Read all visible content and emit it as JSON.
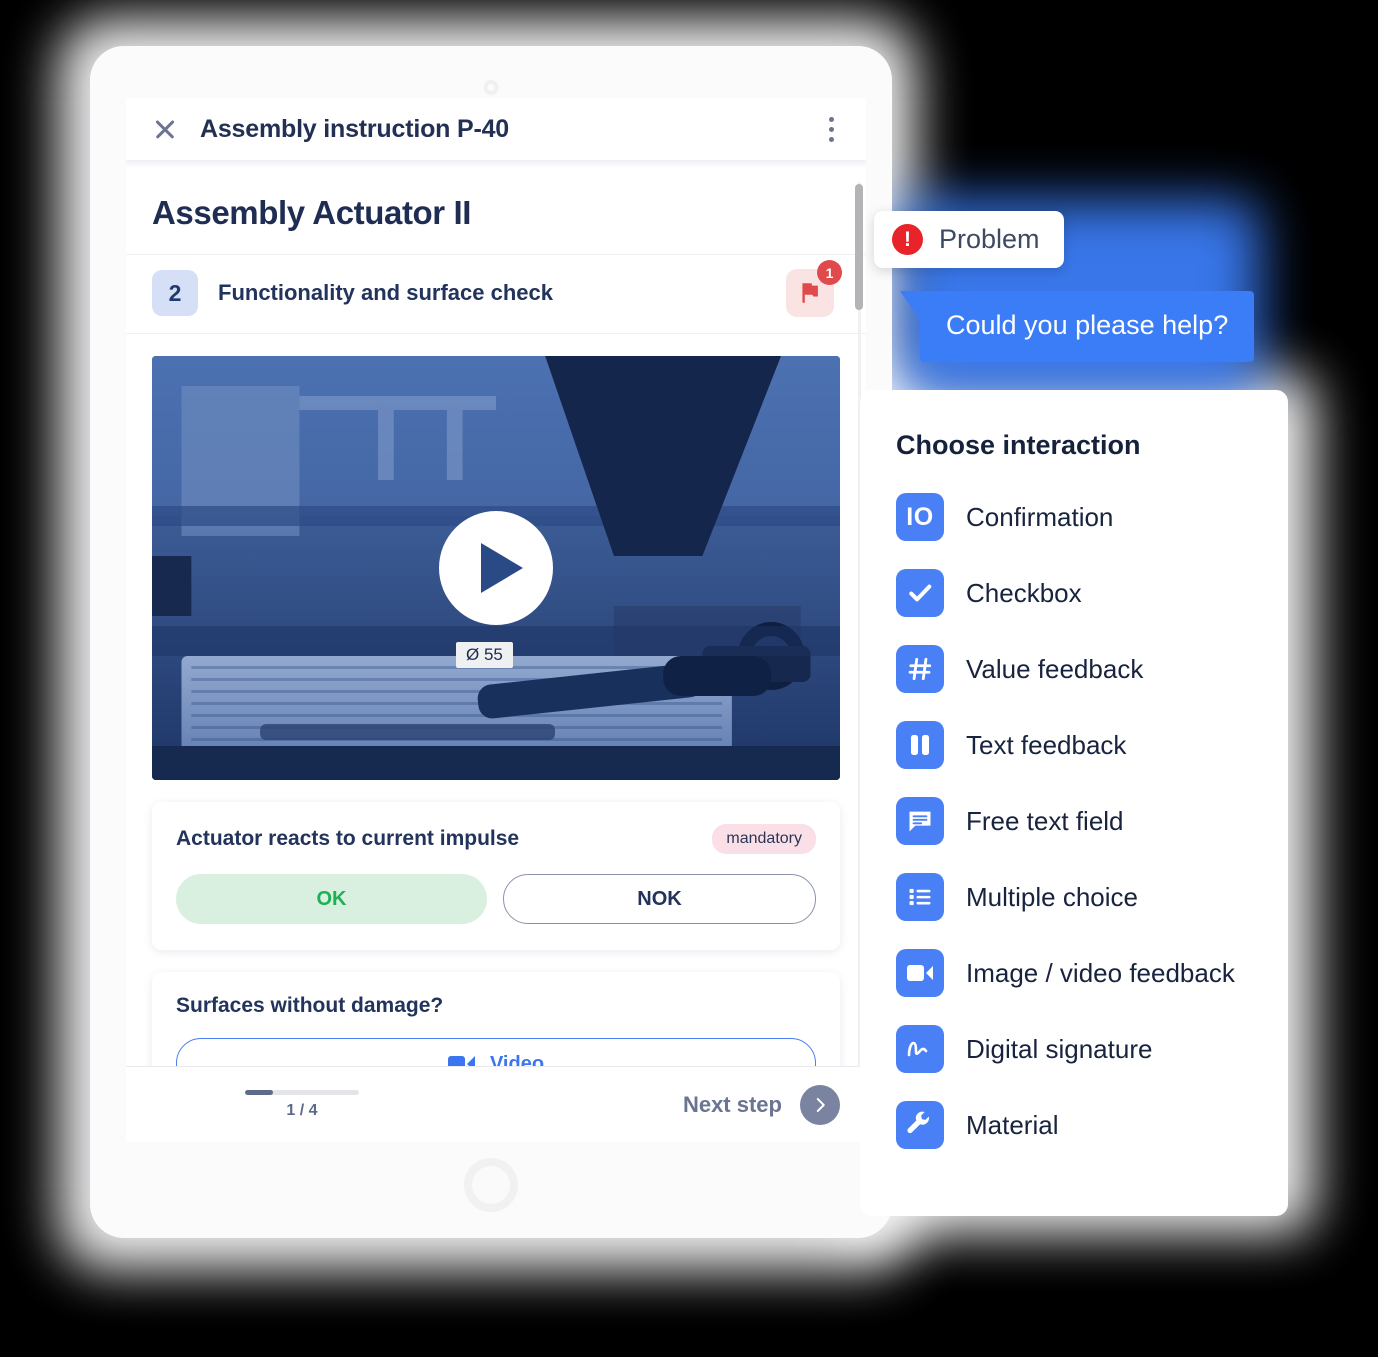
{
  "tablet": {
    "window": {
      "titlebar": {
        "close_icon": "close-icon",
        "title": "Assembly instruction P-40",
        "menu_icon": "kebab-menu-icon"
      },
      "page_title": "Assembly Actuator II",
      "step": {
        "number": "2",
        "label": "Functionality and surface check",
        "flag_icon": "flag-icon",
        "flag_badge_count": "1"
      },
      "media": {
        "play_icon": "play-icon",
        "overlay_label": "Ø 55"
      },
      "cards": [
        {
          "question": "Actuator reacts to current impulse",
          "badge": "mandatory",
          "buttons": [
            {
              "label": "OK",
              "state": "selected"
            },
            {
              "label": "NOK",
              "state": "default"
            }
          ]
        },
        {
          "question": "Surfaces without damage?",
          "buttons": [
            {
              "label": "Video",
              "icon": "video-camera-icon"
            }
          ]
        }
      ],
      "footer": {
        "progress_text": "1 / 4",
        "progress_percent": 25,
        "next_label": "Next step",
        "next_icon": "chevron-right-icon"
      }
    }
  },
  "problem": {
    "icon": "exclamation-circle-icon",
    "label": "Problem",
    "message": "Could you please help?"
  },
  "interaction_panel": {
    "title": "Choose interaction",
    "items": [
      {
        "label": "Confirmation",
        "icon": "io-icon"
      },
      {
        "label": "Checkbox",
        "icon": "checkmark-icon"
      },
      {
        "label": "Value feedback",
        "icon": "hash-icon"
      },
      {
        "label": "Text feedback",
        "icon": "pause-bars-icon"
      },
      {
        "label": "Free text field",
        "icon": "chat-bubble-icon"
      },
      {
        "label": "Multiple choice",
        "icon": "list-icon"
      },
      {
        "label": "Image / video feedback",
        "icon": "video-camera-icon"
      },
      {
        "label": "Digital signature",
        "icon": "signature-icon"
      },
      {
        "label": "Material",
        "icon": "wrench-icon"
      }
    ]
  },
  "colors": {
    "accent_blue": "#4a80f5",
    "bubble_blue": "#3b7df6",
    "problem_red": "#e8232a",
    "ok_green": "#1cb152",
    "navy": "#22335c",
    "mandatory_pink": "#fae0e6"
  }
}
